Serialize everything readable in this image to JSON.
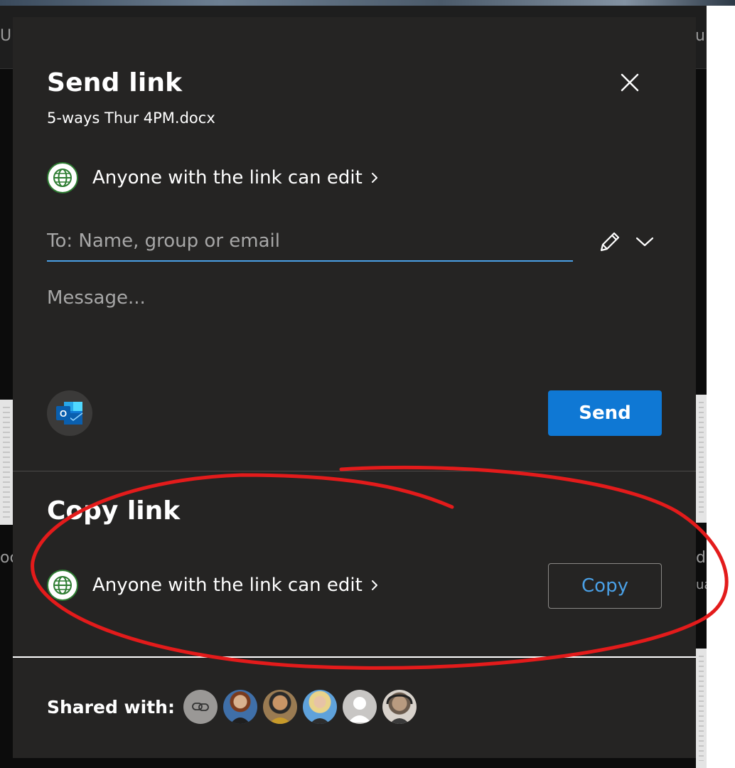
{
  "background": {
    "left_text_top": "Up",
    "right_text_top": "u",
    "left_text_mid": "oc",
    "right_text_mid": "d",
    "right_text_mid2": "ua"
  },
  "dialog": {
    "title": "Send link",
    "filename": "5-ways Thur 4PM.docx",
    "permission_label": "Anyone with the link can edit",
    "to_placeholder": "To: Name, group or email",
    "message_placeholder": "Message...",
    "send_label": "Send",
    "copy_title": "Copy link",
    "copy_permission_label": "Anyone with the link can edit",
    "copy_label": "Copy",
    "shared_with_label": "Shared with:"
  },
  "icons": {
    "close": "close-icon",
    "globe": "globe-icon",
    "chevron_right": "chevron-right-icon",
    "pencil": "pencil-icon",
    "chevron_down": "chevron-down-icon",
    "outlook": "outlook-icon",
    "link": "link-icon"
  },
  "shared_with": [
    {
      "name": "link-avatar",
      "kind": "link"
    },
    {
      "name": "avatar-1",
      "kind": "person",
      "color": "#6b8cb5"
    },
    {
      "name": "avatar-2",
      "kind": "person",
      "color": "#8a6a3c"
    },
    {
      "name": "avatar-3",
      "kind": "person",
      "color": "#6ea6d6"
    },
    {
      "name": "avatar-4",
      "kind": "placeholder"
    },
    {
      "name": "avatar-5",
      "kind": "person",
      "color": "#a79a8a"
    }
  ],
  "colors": {
    "dialog_bg": "#252423",
    "accent": "#0f78d4",
    "link_text": "#4aa0e6",
    "annotation": "#e31b1b"
  }
}
